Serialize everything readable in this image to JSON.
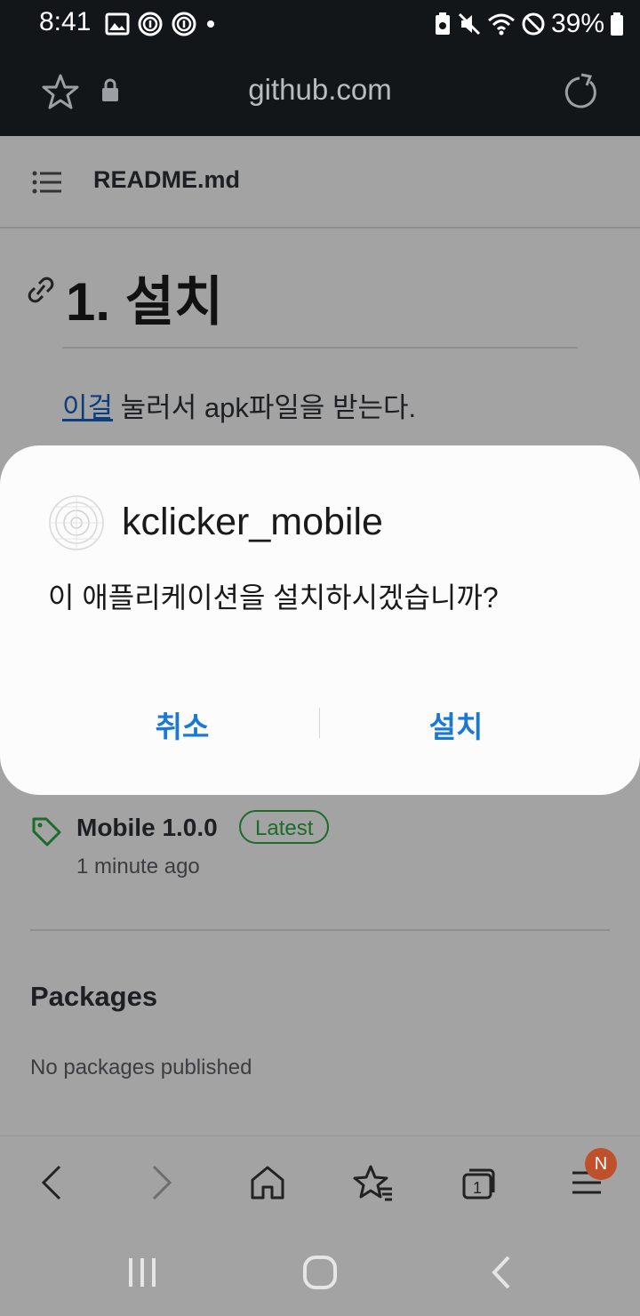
{
  "status_bar": {
    "time": "8:41",
    "battery": "39%",
    "icons": [
      "gallery-icon",
      "fingerprint-icon",
      "fingerprint-icon",
      "dot-icon",
      "battery-saver-icon",
      "mute-icon",
      "wifi-icon",
      "no-disturb-icon",
      "battery-icon"
    ]
  },
  "browser": {
    "url": "github.com"
  },
  "page": {
    "readme_title": "README.md",
    "heading": "1. 설치",
    "link_text": "이걸",
    "paragraph_rest": " 눌러서 apk파일을 받는다.",
    "release": {
      "name": "Mobile 1.0.0",
      "badge": "Latest",
      "time": "1 minute ago"
    },
    "packages": {
      "title": "Packages",
      "text": "No packages published"
    }
  },
  "dialog": {
    "app_name": "kclicker_mobile",
    "question": "이 애플리케이션을 설치하시겠습니까?",
    "cancel_label": "취소",
    "install_label": "설치"
  },
  "toolbar": {
    "tabs_count": "1",
    "notification_badge": "N"
  },
  "colors": {
    "accent": "#1a7ad3",
    "badge_green": "#1b6b2b",
    "notif": "#c0502b",
    "dark_bar": "#121619"
  }
}
